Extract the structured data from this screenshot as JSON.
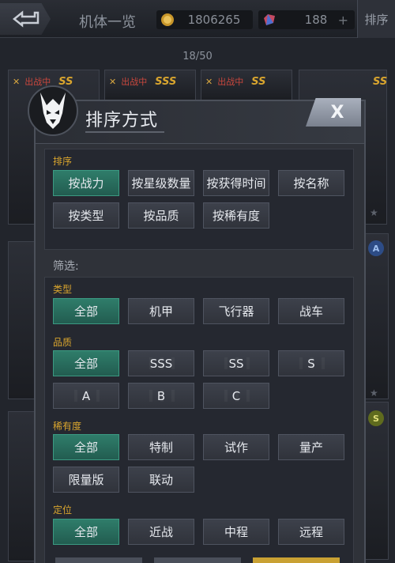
{
  "topbar": {
    "page_title": "机体一览",
    "gold_value": "1806265",
    "gem_value": "188",
    "plus": "+",
    "sort_tab": "排序"
  },
  "counter": "18/50",
  "background_cards": {
    "status_tag": "出战中",
    "rank_label": "SSS",
    "rank_label_alt": "SS",
    "side_badge_a": "A",
    "side_badge_s": "S"
  },
  "modal": {
    "title": "排序方式",
    "close_label": "X",
    "sort_section": {
      "label": "排序",
      "options": [
        "按战力",
        "按星级数量",
        "按获得时间",
        "按名称",
        "按类型",
        "按品质",
        "按稀有度"
      ],
      "selected_index": 0
    },
    "filter_label": "筛选:",
    "type_section": {
      "label": "类型",
      "options": [
        "全部",
        "机甲",
        "飞行器",
        "战车"
      ],
      "selected_index": 0
    },
    "quality_section": {
      "label": "品质",
      "options": [
        "全部",
        "SSS",
        "SS",
        "S",
        "A",
        "B",
        "C"
      ],
      "selected_index": 0
    },
    "rarity_section": {
      "label": "稀有度",
      "options": [
        "全部",
        "特制",
        "试作",
        "量产",
        "限量版",
        "联动"
      ],
      "selected_index": 0
    },
    "position_section": {
      "label": "定位",
      "options": [
        "全部",
        "近战",
        "中程",
        "远程"
      ],
      "selected_index": 0
    }
  },
  "colors": {
    "selected_button": "#2f7d6a",
    "accent_gold": "#d9a52e",
    "status_red": "#c9473d"
  }
}
